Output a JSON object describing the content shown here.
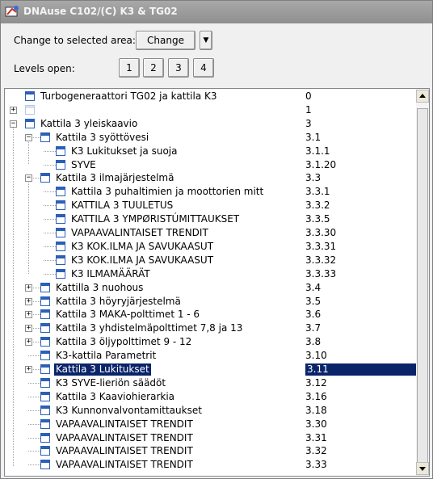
{
  "window": {
    "title": "DNAuse C102/(C) K3 & TG02"
  },
  "controls": {
    "change_area_label": "Change to selected area:",
    "change_button": "Change",
    "dropdown_symbol": "▼",
    "levels_label": "Levels open:",
    "levels": [
      "1",
      "2",
      "3",
      "4"
    ]
  },
  "tree": {
    "rows": [
      {
        "label": "Turbogeneraattori TG02 ja kattila K3",
        "num": "0",
        "depth": 0,
        "expander": "none",
        "icon": "page",
        "selected": false
      },
      {
        "label": "",
        "num": "1",
        "depth": 0,
        "expander": "plus",
        "icon": "blank",
        "selected": false
      },
      {
        "label": "Kattila 3 yleiskaavio",
        "num": "3",
        "depth": 0,
        "expander": "minus",
        "icon": "page",
        "selected": false
      },
      {
        "label": "Kattila 3 syöttövesi",
        "num": "3.1",
        "depth": 1,
        "expander": "minus",
        "icon": "page",
        "selected": false
      },
      {
        "label": "K3 Lukitukset ja suoja",
        "num": "3.1.1",
        "depth": 2,
        "expander": "none",
        "icon": "page",
        "selected": false
      },
      {
        "label": "SYVE",
        "num": "3.1.20",
        "depth": 2,
        "expander": "none",
        "icon": "page",
        "selected": false
      },
      {
        "label": "Kattila 3 ilmajärjestelmä",
        "num": "3.3",
        "depth": 1,
        "expander": "minus",
        "icon": "page",
        "selected": false
      },
      {
        "label": "Kattila 3 puhaltimien ja moottorien mitt",
        "num": "3.3.1",
        "depth": 2,
        "expander": "none",
        "icon": "page",
        "selected": false
      },
      {
        "label": "KATTILA 3 TUULETUS",
        "num": "3.3.2",
        "depth": 2,
        "expander": "none",
        "icon": "page",
        "selected": false
      },
      {
        "label": "KATTILA 3 YMPØRISTÚMITTAUKSET",
        "num": "3.3.5",
        "depth": 2,
        "expander": "none",
        "icon": "page",
        "selected": false
      },
      {
        "label": "VAPAAVALINTAISET TRENDIT",
        "num": "3.3.30",
        "depth": 2,
        "expander": "none",
        "icon": "page",
        "selected": false
      },
      {
        "label": "K3 KOK.ILMA JA SAVUKAASUT",
        "num": "3.3.31",
        "depth": 2,
        "expander": "none",
        "icon": "page",
        "selected": false
      },
      {
        "label": "K3 KOK.ILMA JA SAVUKAASUT",
        "num": "3.3.32",
        "depth": 2,
        "expander": "none",
        "icon": "page",
        "selected": false
      },
      {
        "label": "K3 ILMAMÄÄRÄT",
        "num": "3.3.33",
        "depth": 2,
        "expander": "none",
        "icon": "page",
        "selected": false
      },
      {
        "label": "Kattilla 3 nuohous",
        "num": "3.4",
        "depth": 1,
        "expander": "plus",
        "icon": "page",
        "selected": false
      },
      {
        "label": "Kattila 3 höyryjärjestelmä",
        "num": "3.5",
        "depth": 1,
        "expander": "plus",
        "icon": "page",
        "selected": false
      },
      {
        "label": "Kattila 3 MAKA-polttimet 1 - 6",
        "num": "3.6",
        "depth": 1,
        "expander": "plus",
        "icon": "page",
        "selected": false
      },
      {
        "label": "Kattila 3 yhdistelmäpolttimet 7,8 ja 13",
        "num": "3.7",
        "depth": 1,
        "expander": "plus",
        "icon": "page",
        "selected": false
      },
      {
        "label": "Kattila 3 öljypolttimet 9 - 12",
        "num": "3.8",
        "depth": 1,
        "expander": "plus",
        "icon": "page",
        "selected": false
      },
      {
        "label": "K3-kattila Parametrit",
        "num": "3.10",
        "depth": 1,
        "expander": "none",
        "icon": "page",
        "selected": false
      },
      {
        "label": "Kattila 3 Lukitukset",
        "num": "3.11",
        "depth": 1,
        "expander": "plus",
        "icon": "page",
        "selected": true
      },
      {
        "label": "K3 SYVE-lieriön säädöt",
        "num": "3.12",
        "depth": 1,
        "expander": "none",
        "icon": "page",
        "selected": false
      },
      {
        "label": "Kattila 3 Kaaviohierarkia",
        "num": "3.16",
        "depth": 1,
        "expander": "none",
        "icon": "page",
        "selected": false
      },
      {
        "label": "K3 Kunnonvalvontamittaukset",
        "num": "3.18",
        "depth": 1,
        "expander": "none",
        "icon": "page",
        "selected": false
      },
      {
        "label": "VAPAAVALINTAISET TRENDIT",
        "num": "3.30",
        "depth": 1,
        "expander": "none",
        "icon": "page",
        "selected": false
      },
      {
        "label": "VAPAAVALINTAISET TRENDIT",
        "num": "3.31",
        "depth": 1,
        "expander": "none",
        "icon": "page",
        "selected": false
      },
      {
        "label": "VAPAAVALINTAISET TRENDIT",
        "num": "3.32",
        "depth": 1,
        "expander": "none",
        "icon": "page",
        "selected": false
      },
      {
        "label": "VAPAAVALINTAISET TRENDIT",
        "num": "3.33",
        "depth": 1,
        "expander": "none",
        "icon": "page",
        "selected": false
      }
    ]
  },
  "scrollbar": {
    "up_arrow": "▲",
    "down_arrow": "▼"
  }
}
